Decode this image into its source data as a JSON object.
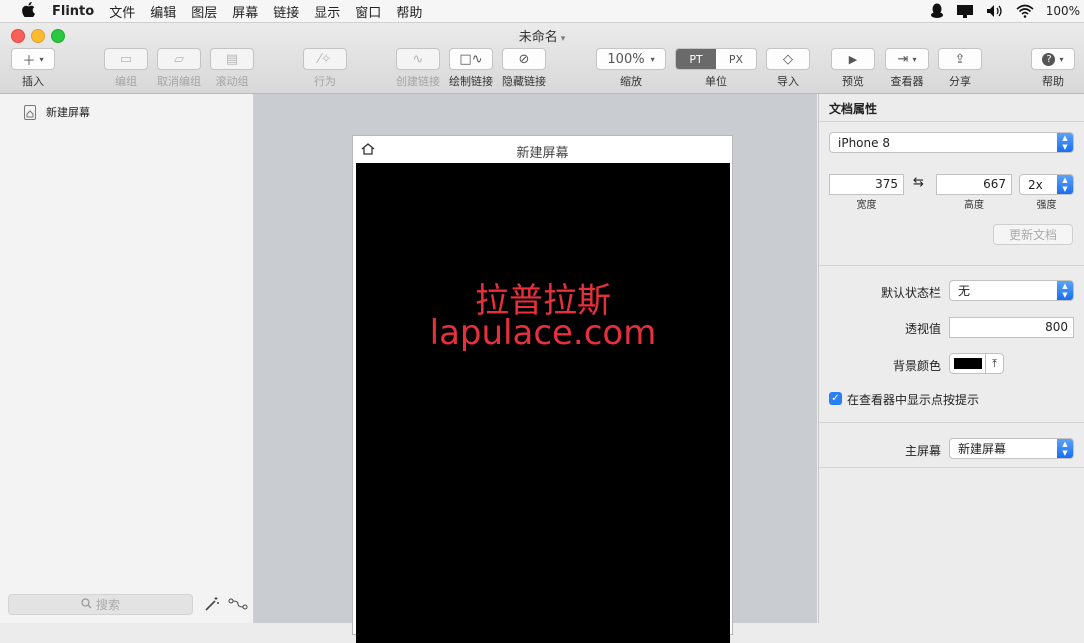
{
  "menubar": {
    "app": "Flinto",
    "items": [
      "文件",
      "编辑",
      "图层",
      "屏幕",
      "链接",
      "显示",
      "窗口",
      "帮助"
    ],
    "battery": "100%"
  },
  "window": {
    "title": "未命名"
  },
  "toolbar": {
    "insert": "插入",
    "edit": "编组",
    "ungroup": "取消编组",
    "scroll_group": "滚动组",
    "behavior": "行为",
    "create_link": "创建链接",
    "draw_link": "绘制链接",
    "hide_link": "隐藏链接",
    "zoom_value": "100%",
    "zoom": "缩放",
    "unit_pt": "PT",
    "unit_px": "PX",
    "unit": "单位",
    "import": "导入",
    "preview": "预览",
    "viewer": "查看器",
    "share": "分享",
    "help": "帮助"
  },
  "sidebar": {
    "item": "新建屏幕",
    "search_placeholder": "搜索"
  },
  "canvas": {
    "screen_title": "新建屏幕",
    "watermark_line1": "拉普拉斯",
    "watermark_line2": "lapulace.com",
    "watermark_color": "#e8303c"
  },
  "inspector": {
    "title": "文档属性",
    "device": "iPhone 8",
    "width": "375",
    "height": "667",
    "scale": "2x",
    "width_label": "宽度",
    "height_label": "高度",
    "scale_label": "强度",
    "update_button": "更新文档",
    "statusbar_label": "默认状态栏",
    "statusbar_value": "无",
    "perspective_label": "透视值",
    "perspective_value": "800",
    "bgcolor_label": "背景颜色",
    "bgcolor_value": "#000000",
    "show_hints_label": "在查看器中显示点按提示",
    "main_screen_label": "主屏幕",
    "main_screen_value": "新建屏幕"
  }
}
